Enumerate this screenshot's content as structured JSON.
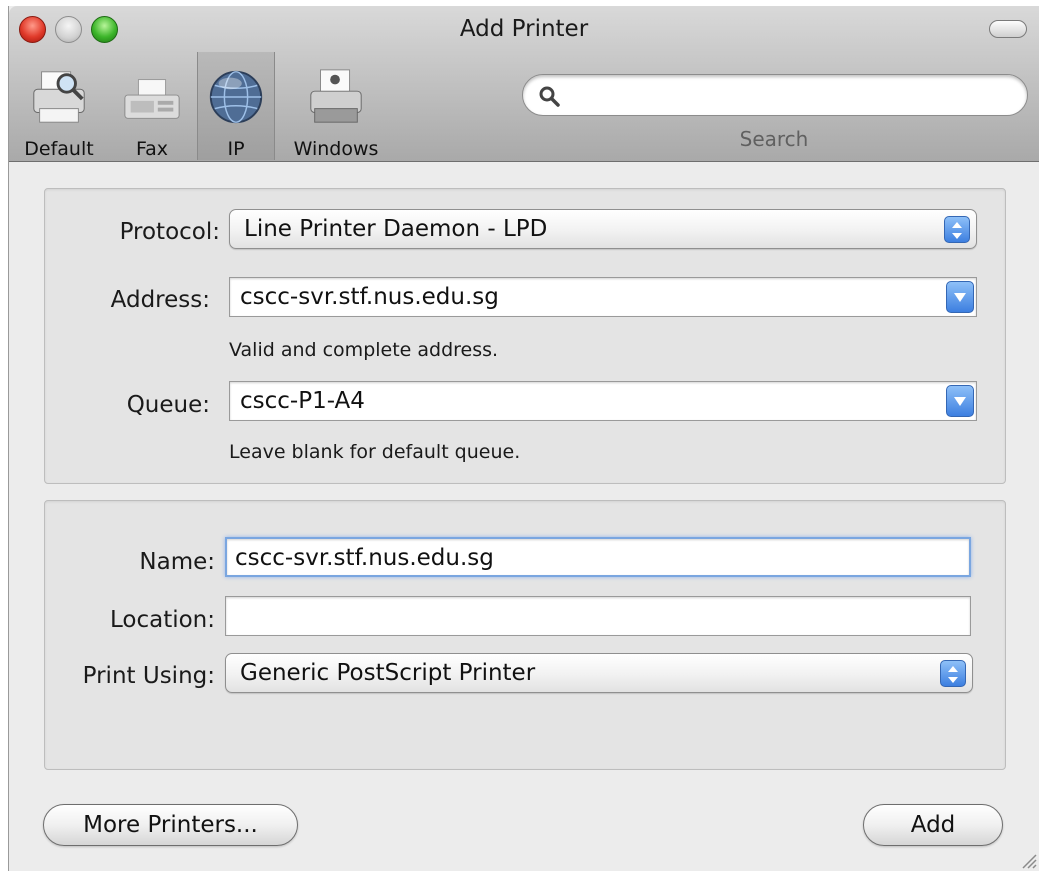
{
  "window": {
    "title": "Add Printer"
  },
  "toolbar": {
    "items": [
      {
        "label": "Default",
        "icon": "default-printer-icon"
      },
      {
        "label": "Fax",
        "icon": "fax-icon"
      },
      {
        "label": "IP",
        "icon": "globe-icon",
        "selected": true
      },
      {
        "label": "Windows",
        "icon": "windows-printer-icon"
      }
    ],
    "search": {
      "label": "Search",
      "value": "",
      "placeholder": ""
    }
  },
  "connection": {
    "protocol_label": "Protocol:",
    "protocol_value": "Line Printer Daemon - LPD",
    "address_label": "Address:",
    "address_value": "cscc-svr.stf.nus.edu.sg",
    "address_hint": "Valid and complete address.",
    "queue_label": "Queue:",
    "queue_value": "cscc-P1-A4",
    "queue_hint": "Leave blank for default queue."
  },
  "details": {
    "name_label": "Name:",
    "name_value": "cscc-svr.stf.nus.edu.sg",
    "location_label": "Location:",
    "location_value": "",
    "print_using_label": "Print Using:",
    "print_using_value": "Generic PostScript Printer"
  },
  "footer": {
    "more_printers_label": "More Printers...",
    "add_label": "Add"
  },
  "colors": {
    "accent": "#3d7fe0",
    "close": "#e03a2a",
    "zoom": "#3cb52a"
  }
}
